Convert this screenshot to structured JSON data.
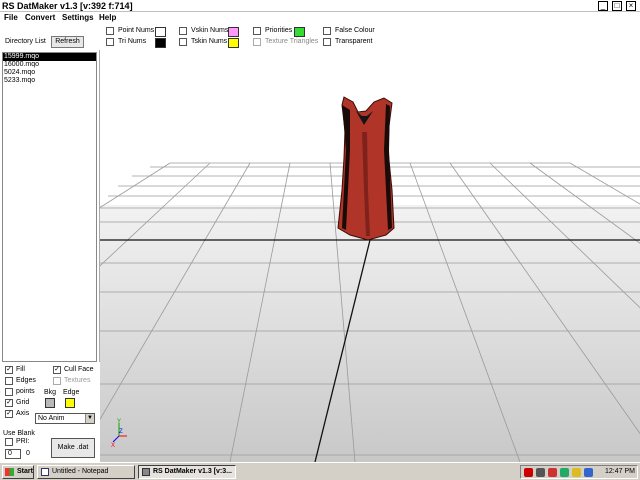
{
  "window": {
    "title": "RS DatMaker v1.3  [v:392 f:714]",
    "controls": {
      "minimize": "_",
      "maximize": "□",
      "close": "×"
    }
  },
  "menu": [
    "File",
    "Convert",
    "Settings",
    "Help"
  ],
  "toolbar": {
    "directory_list_label": "Directory List",
    "refresh_button": "Refresh",
    "point_nums": "Point Nums",
    "tri_nums": "Tri Nums",
    "vskin_nums": "Vskin Nums",
    "tskin_nums": "Tskin Nums",
    "priorities": "Priorities",
    "texture_triangles": "Texture Triangles",
    "false_colour": "False Colour",
    "transparent": "Transparent",
    "colors": {
      "point_nums": "#ffffff",
      "tri_nums": "#000000",
      "vskin_nums": "#ff99ff",
      "tskin_nums": "#ffff00",
      "priorities": "#33dd33"
    }
  },
  "files": [
    "15999.mqo",
    "16000.mqo",
    "5024.mqo",
    "5233.mqo"
  ],
  "selected_file_index": 0,
  "render_options": {
    "fill": {
      "label": "Fill",
      "checked": true
    },
    "edges": {
      "label": "Edges",
      "checked": false
    },
    "points": {
      "label": "points",
      "checked": false
    },
    "grid": {
      "label": "Grid",
      "checked": true
    },
    "axis": {
      "label": "Axis",
      "checked": true
    },
    "cull_face": {
      "label": "Cull Face",
      "checked": true
    },
    "textures": {
      "label": "Textures",
      "checked": false,
      "disabled": true
    },
    "bkg_label": "Bkg",
    "edge_label": "Edge",
    "bkg_color": "#b8b8b8",
    "edge_color": "#ffff00",
    "anim_select": "No Anim",
    "use_blank_label": "Use Blank",
    "pri_label": "PRI:",
    "pri_value": "0",
    "pri_extra": "0",
    "make_dat_button": "Make .dat"
  },
  "viewport": {
    "axis_labels": {
      "y": "Y",
      "z": "Z",
      "x": "X"
    },
    "model_color": "#b03428"
  },
  "taskbar": {
    "start": "Start",
    "items": [
      {
        "label": "Untitled - Notepad",
        "active": false
      },
      {
        "label": "RS DatMaker v1.3  [v:3...",
        "active": true
      }
    ],
    "clock": "12:47 PM"
  }
}
